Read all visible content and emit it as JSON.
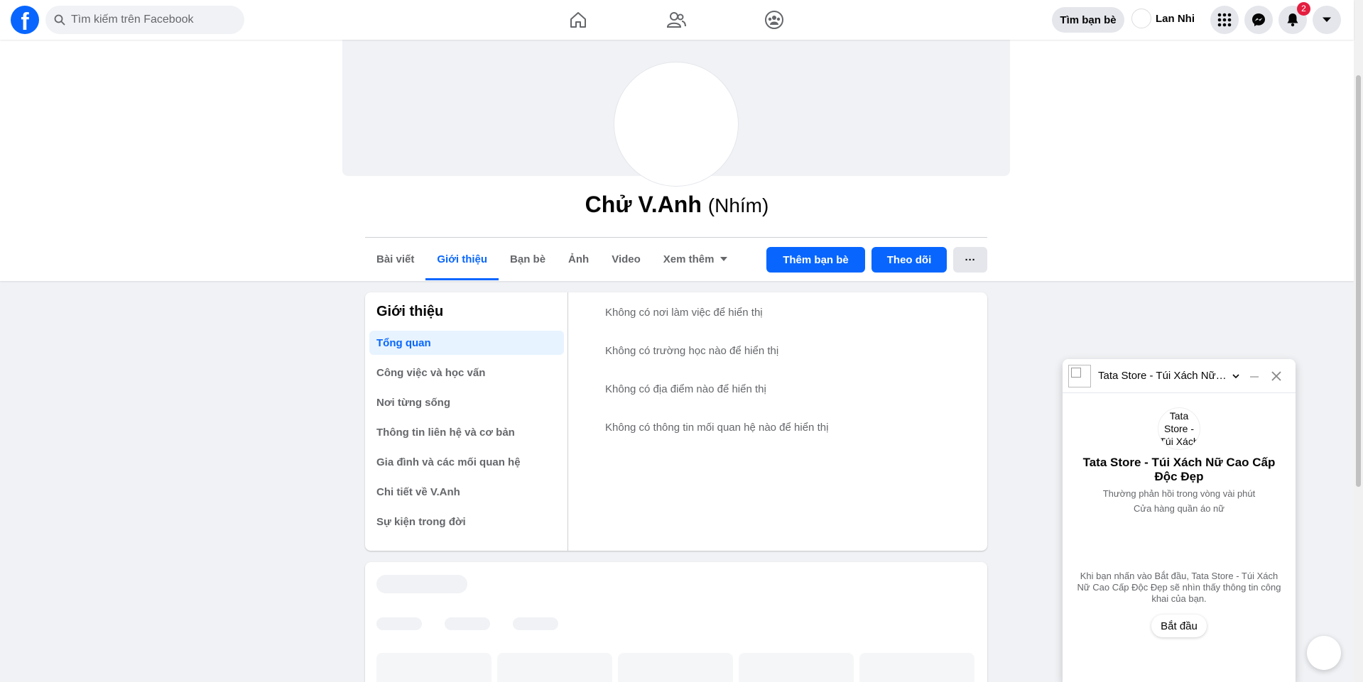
{
  "nav": {
    "logo": "f",
    "search_placeholder": "Tìm kiếm trên Facebook",
    "icons": [
      "home-icon",
      "friends-icon",
      "groups-icon"
    ],
    "find_friends_label": "Tìm bạn bè",
    "user_name": "Lan Nhi",
    "notifications_count": "2",
    "right_icons": [
      "menu-grid-icon",
      "messenger-icon",
      "bell-icon",
      "caret-down-icon"
    ]
  },
  "profile": {
    "name": "Chử V.Anh",
    "alternate_name": "(Nhím)",
    "tabs": [
      {
        "label": "Bài viết",
        "active": false
      },
      {
        "label": "Giới thiệu",
        "active": true
      },
      {
        "label": "Bạn bè",
        "active": false
      },
      {
        "label": "Ảnh",
        "active": false
      },
      {
        "label": "Video",
        "active": false
      },
      {
        "label": "Xem thêm",
        "active": false
      }
    ],
    "add_friend_label": "Thêm bạn bè",
    "follow_label": "Theo dõi",
    "more_label": "···"
  },
  "about": {
    "title": "Giới thiệu",
    "menu": [
      {
        "label": "Tổng quan",
        "active": true
      },
      {
        "label": "Công việc và học vấn",
        "active": false
      },
      {
        "label": "Nơi từng sống",
        "active": false
      },
      {
        "label": "Thông tin liên hệ và cơ bản",
        "active": false
      },
      {
        "label": "Gia đình và các mối quan hệ",
        "active": false
      },
      {
        "label": "Chi tiết về V.Anh",
        "active": false
      },
      {
        "label": "Sự kiện trong đời",
        "active": false
      }
    ],
    "rows": [
      "Không có nơi làm việc để hiển thị",
      "Không có trường học nào để hiển thị",
      "Không có địa điểm nào để hiển thị",
      "Không có thông tin mối quan hệ nào để hiển thị"
    ]
  },
  "chat": {
    "header_title": "Tata Store - Túi Xách Nữ Cao Cấp Độc Đẹp",
    "avatar_alt": "Tata Store - Túi Xách",
    "page_name": "Tata Store - Túi Xách Nữ Cao Cấp Độc Đẹp",
    "response_time": "Thường phản hồi trong vòng vài phút",
    "category": "Cửa hàng quần áo nữ",
    "consent_text": "Khi bạn nhấn vào Bắt đầu, Tata Store - Túi Xách Nữ Cao Cấp Độc Đẹp sẽ nhìn thấy thông tin công khai của bạn.",
    "start_label": "Bắt đầu"
  },
  "colors": {
    "accent": "#0866ff",
    "badge": "#e41e3f",
    "background": "#f0f2f5"
  }
}
